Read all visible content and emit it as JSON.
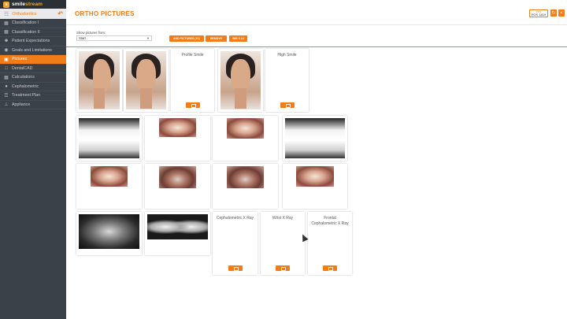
{
  "app": {
    "brand_prefix": "smile",
    "brand_suffix": "stream",
    "section_label": "Orthodontics"
  },
  "sidebar": {
    "items": [
      {
        "label": "Classification I",
        "icon": "clipboard-icon"
      },
      {
        "label": "Classification II",
        "icon": "clipboard-icon"
      },
      {
        "label": "Patient Expectations",
        "icon": "person-icon"
      },
      {
        "label": "Goals and Limitations",
        "icon": "target-icon"
      },
      {
        "label": "Pictures",
        "icon": "picture-icon"
      },
      {
        "label": "DentalCAD",
        "icon": "cad-icon"
      },
      {
        "label": "Calculations",
        "icon": "calculator-icon"
      },
      {
        "label": "Cephalometric",
        "icon": "head-icon"
      },
      {
        "label": "Treatment Plan",
        "icon": "checklist-icon"
      },
      {
        "label": "Appliance",
        "icon": "appliance-icon"
      }
    ],
    "active": "Pictures"
  },
  "header": {
    "title": "ORTHO PICTURES",
    "pos_small": "POS",
    "pos_number": "POS 1819"
  },
  "toolbar": {
    "show_label": "Show pictures from:",
    "select_value": "Start",
    "buttons": [
      "ADD PICTURES (X1)",
      "REMOVE",
      "BIG X 10"
    ]
  },
  "cards": {
    "profile_smile": "Profile Smile",
    "high_smile": "High Smile",
    "ceph_xray": "Cephalometric X Ray",
    "wrist_xray": "Wrist X Ray",
    "frontal_ceph_xray": "Frontal Cephalometric X Ray"
  },
  "colors": {
    "accent": "#f07c1a",
    "sidebar_bg": "#3b4148"
  }
}
